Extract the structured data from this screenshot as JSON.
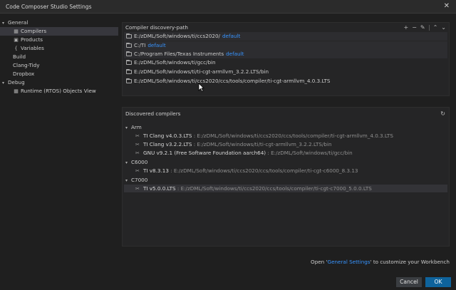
{
  "window": {
    "title": "Code Composer Studio Settings"
  },
  "sidebar": {
    "items": [
      {
        "label": "General",
        "chevron": "▾"
      },
      {
        "label": "Compilers",
        "icon": "compiler-grid-icon"
      },
      {
        "label": "Products",
        "icon": "product-box-icon"
      },
      {
        "label": "Variables",
        "icon": "variable-braces-icon"
      },
      {
        "label": "Build"
      },
      {
        "label": "Clang-Tidy"
      },
      {
        "label": "Dropbox"
      },
      {
        "label": "Debug",
        "chevron": "▾"
      },
      {
        "label": "Runtime (RTOS) Objects View",
        "icon": "rtos-grid-icon"
      }
    ]
  },
  "discovery": {
    "title": "Compiler discovery-path",
    "default_label": "default",
    "paths": [
      {
        "path": "E:/zDML/Soft/windows/ti/ccs2020/",
        "is_default": true
      },
      {
        "path": "C:/TI",
        "is_default": true
      },
      {
        "path": "C:/Program Files/Texas Instruments",
        "is_default": true
      },
      {
        "path": "E:/zDML/Soft/windows/ti/gcc/bin",
        "is_default": false
      },
      {
        "path": "E:/zDML/Soft/windows/ti/ti-cgt-armllvm_3.2.2.LTS/bin",
        "is_default": false
      },
      {
        "path": "E:/zDML/Soft/windows/ti/ccs2020/ccs/tools/compiler/ti-cgt-armllvm_4.0.3.LTS",
        "is_default": false
      }
    ]
  },
  "discovered": {
    "title": "Discovered compilers",
    "groups": [
      {
        "name": "Arm",
        "compilers": [
          {
            "name": "TI Clang v4.0.3.LTS",
            "path": "E:/zDML/Soft/windows/ti/ccs2020/ccs/tools/compiler/ti-cgt-armllvm_4.0.3.LTS"
          },
          {
            "name": "TI Clang v3.2.2.LTS",
            "path": "E:/zDML/Soft/windows/ti/ti-cgt-armllvm_3.2.2.LTS/bin"
          },
          {
            "name": "GNU v9.2.1 (Free Software Foundation aarch64)",
            "path": "E:/zDML/Soft/windows/ti/gcc/bin"
          }
        ]
      },
      {
        "name": "C6000",
        "compilers": [
          {
            "name": "TI v8.3.13",
            "path": "E:/zDML/Soft/windows/ti/ccs2020/ccs/tools/compiler/ti-cgt-c6000_8.3.13"
          }
        ]
      },
      {
        "name": "C7000",
        "compilers": [
          {
            "name": "TI v5.0.0.LTS",
            "path": "E:/zDML/Soft/windows/ti/ccs2020/ccs/tools/compiler/ti-cgt-c7000_5.0.0.LTS"
          }
        ]
      }
    ]
  },
  "footer": {
    "prefix": "Open '",
    "link": "General Settings",
    "suffix": "' to customize your Workbench",
    "cancel": "Cancel",
    "ok": "OK"
  },
  "colors": {
    "accent": "#3794ff",
    "primary_button": "#0e639c",
    "background": "#1f1f1f"
  }
}
